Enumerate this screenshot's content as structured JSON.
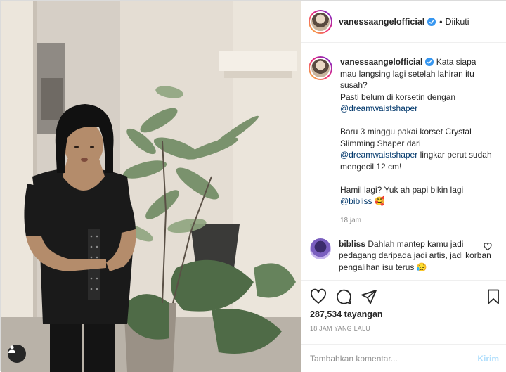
{
  "post": {
    "username": "vanessaangelofficial",
    "follow_status": "Diikuti",
    "caption": {
      "line1": "Kata siapa mau langsing lagi setelah lahiran itu susah?",
      "line2_prefix": "Pasti belum di korsetin dengan",
      "mention1": "@dreamwaistshaper",
      "para2_prefix": "Baru 3 minggu pakai korset Crystal Slimming Shaper dari",
      "mention2": "@dreamwaistshaper",
      "para2_suffix": "lingkar perut sudah mengecil 12 cm!",
      "para3_prefix": "Hamil lagi? Yuk ah papi bikin lagi",
      "mention3": "@bibliss",
      "emoji": "🥰"
    },
    "caption_time": "18 jam",
    "comment": {
      "username": "bibliss",
      "text": "Dahlah mantep kamu jadi pedagang daripada jadi artis, jadi korban pengalihan isu terus 😥"
    },
    "views": "287,534 tayangan",
    "posted_ago": "18 JAM YANG LALU",
    "comment_placeholder": "Tambahkan komentar...",
    "send_label": "Kirim"
  },
  "icons": {
    "header_more": "more-horizontal-icon",
    "like": "heart-icon",
    "comment": "comment-icon",
    "share": "send-icon",
    "save": "bookmark-icon",
    "tags": "user-tag-icon",
    "verified": "verified-badge-icon"
  },
  "colors": {
    "verified_blue": "#3897f0",
    "link_blue": "#00376b",
    "send_disabled": "#b2dffc"
  }
}
